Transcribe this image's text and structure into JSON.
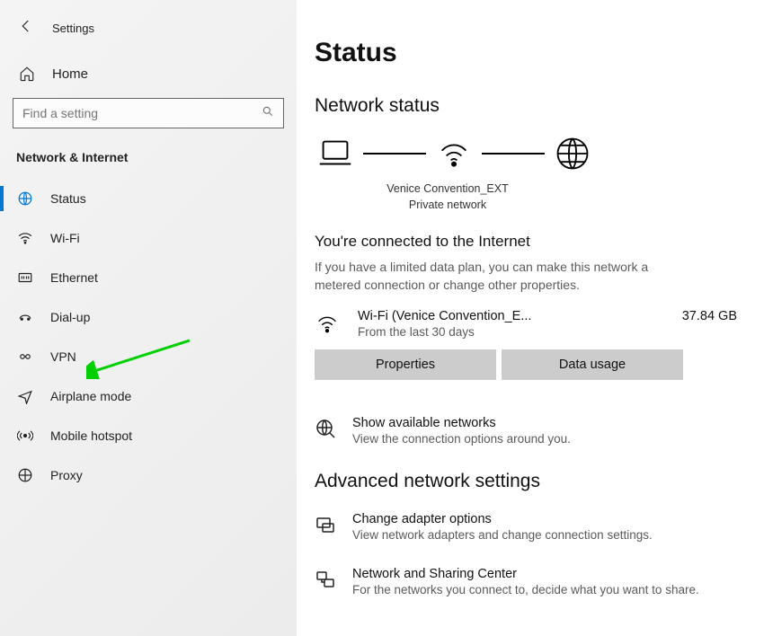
{
  "app_title": "Settings",
  "home_label": "Home",
  "search_placeholder": "Find a setting",
  "section_title": "Network & Internet",
  "nav": {
    "status": "Status",
    "wifi": "Wi-Fi",
    "ethernet": "Ethernet",
    "dialup": "Dial-up",
    "vpn": "VPN",
    "airplane": "Airplane mode",
    "hotspot": "Mobile hotspot",
    "proxy": "Proxy"
  },
  "page": {
    "title": "Status",
    "network_status_heading": "Network status",
    "diagram": {
      "ssid": "Venice Convention_EXT",
      "net_type": "Private network"
    },
    "connected_title": "You're connected to the Internet",
    "connected_desc": "If you have a limited data plan, you can make this network a metered connection or change other properties.",
    "connection": {
      "name": "Wi-Fi (Venice Convention_E...",
      "sub": "From the last 30 days",
      "size": "37.84 GB"
    },
    "buttons": {
      "properties": "Properties",
      "data_usage": "Data usage"
    },
    "available": {
      "title": "Show available networks",
      "desc": "View the connection options around you."
    },
    "advanced_heading": "Advanced network settings",
    "adapter": {
      "title": "Change adapter options",
      "desc": "View network adapters and change connection settings."
    },
    "sharing": {
      "title": "Network and Sharing Center",
      "desc": "For the networks you connect to, decide what you want to share."
    }
  }
}
